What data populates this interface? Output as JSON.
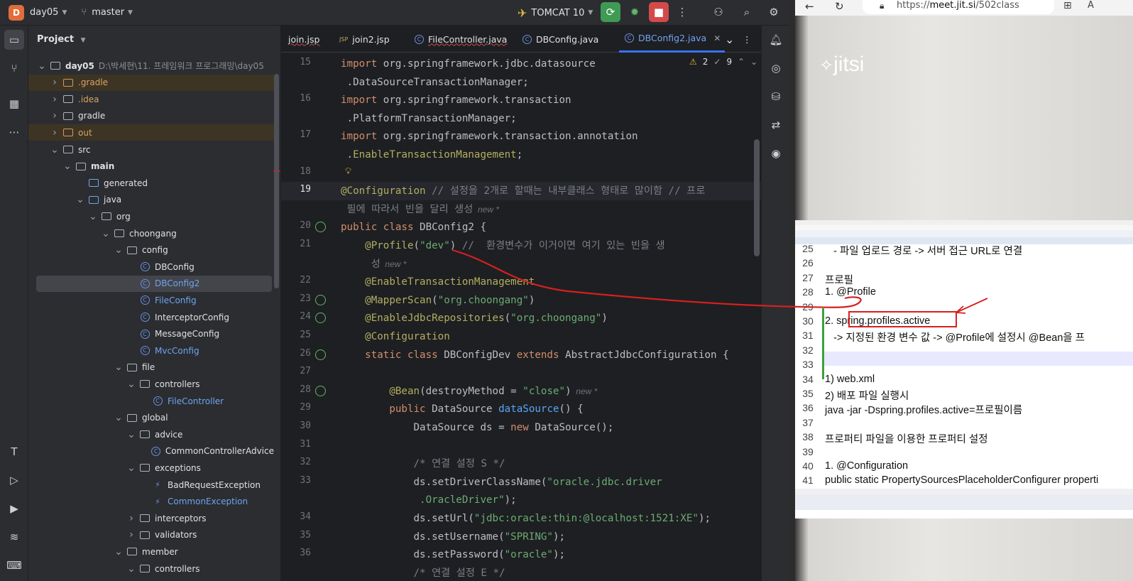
{
  "ide": {
    "project_name": "day05",
    "branch": "master",
    "run_config": "TOMCAT 10",
    "project_panel_title": "Project",
    "tree": [
      {
        "label": "day05",
        "path": "D:\\박세현\\11. 프레임워크 프로그래밍\\day05",
        "indent": 0,
        "arrow": "v",
        "icon": "folder",
        "bold": true
      },
      {
        "label": ".gradle",
        "indent": 1,
        "arrow": ">",
        "icon": "folder-orange",
        "color": "orange",
        "excluded": true
      },
      {
        "label": ".idea",
        "indent": 1,
        "arrow": ">",
        "icon": "folder",
        "color": "orange"
      },
      {
        "label": "gradle",
        "indent": 1,
        "arrow": ">",
        "icon": "folder"
      },
      {
        "label": "out",
        "indent": 1,
        "arrow": ">",
        "icon": "folder-orange",
        "color": "orange",
        "excluded": true
      },
      {
        "label": "src",
        "indent": 1,
        "arrow": "v",
        "icon": "folder"
      },
      {
        "label": "main",
        "indent": 2,
        "arrow": "v",
        "icon": "folder",
        "bold": true
      },
      {
        "label": "generated",
        "indent": 3,
        "arrow": "",
        "icon": "folder-blue"
      },
      {
        "label": "java",
        "indent": 3,
        "arrow": "v",
        "icon": "folder-blue"
      },
      {
        "label": "org",
        "indent": 4,
        "arrow": "v",
        "icon": "package"
      },
      {
        "label": "choongang",
        "indent": 5,
        "arrow": "v",
        "icon": "package"
      },
      {
        "label": "config",
        "indent": 6,
        "arrow": "v",
        "icon": "package"
      },
      {
        "label": "DBConfig",
        "indent": 7,
        "arrow": "",
        "icon": "class"
      },
      {
        "label": "DBConfig2",
        "indent": 7,
        "arrow": "",
        "icon": "class",
        "selected": true,
        "color": "blue"
      },
      {
        "label": "FileConfig",
        "indent": 7,
        "arrow": "",
        "icon": "class",
        "color": "blue"
      },
      {
        "label": "InterceptorConfig",
        "indent": 7,
        "arrow": "",
        "icon": "class"
      },
      {
        "label": "MessageConfig",
        "indent": 7,
        "arrow": "",
        "icon": "class"
      },
      {
        "label": "MvcConfig",
        "indent": 7,
        "arrow": "",
        "icon": "class",
        "color": "blue"
      },
      {
        "label": "file",
        "indent": 6,
        "arrow": "v",
        "icon": "package"
      },
      {
        "label": "controllers",
        "indent": 7,
        "arrow": "v",
        "icon": "package"
      },
      {
        "label": "FileController",
        "indent": 8,
        "arrow": "",
        "icon": "class",
        "color": "blue"
      },
      {
        "label": "global",
        "indent": 6,
        "arrow": "v",
        "icon": "package"
      },
      {
        "label": "advice",
        "indent": 7,
        "arrow": "v",
        "icon": "package"
      },
      {
        "label": "CommonControllerAdvice",
        "indent": 8,
        "arrow": "",
        "icon": "class"
      },
      {
        "label": "exceptions",
        "indent": 7,
        "arrow": "v",
        "icon": "package"
      },
      {
        "label": "BadRequestException",
        "indent": 8,
        "arrow": "",
        "icon": "exception"
      },
      {
        "label": "CommonException",
        "indent": 8,
        "arrow": "",
        "icon": "exception",
        "color": "blue"
      },
      {
        "label": "interceptors",
        "indent": 7,
        "arrow": ">",
        "icon": "package"
      },
      {
        "label": "validators",
        "indent": 7,
        "arrow": ">",
        "icon": "package"
      },
      {
        "label": "member",
        "indent": 6,
        "arrow": "v",
        "icon": "package"
      },
      {
        "label": "controllers",
        "indent": 7,
        "arrow": "v",
        "icon": "package"
      }
    ],
    "tabs": [
      {
        "label": "join.jsp",
        "icon": "jsp",
        "error": true
      },
      {
        "label": "join2.jsp",
        "icon": "jsp",
        "error": false
      },
      {
        "label": "FileController.java",
        "icon": "class",
        "error": true
      },
      {
        "label": "DBConfig.java",
        "icon": "class",
        "error": false
      },
      {
        "label": "DBConfig2.java",
        "icon": "class",
        "error": false,
        "active": true
      }
    ],
    "inspections": {
      "warnings": "2",
      "weak_warnings": "9"
    },
    "hint_new": "new *",
    "code_lines": [
      {
        "n": "15",
        "parts": [
          [
            "kw",
            "import "
          ],
          [
            "pl",
            "org.springframework.jdbc.datasource"
          ]
        ]
      },
      {
        "n": "",
        "parts": [
          [
            "pl",
            " .DataSourceTransactionManager;"
          ]
        ]
      },
      {
        "n": "16",
        "parts": [
          [
            "kw",
            "import "
          ],
          [
            "pl",
            "org.springframework.transaction"
          ]
        ]
      },
      {
        "n": "",
        "parts": [
          [
            "pl",
            " .PlatformTransactionManager;"
          ]
        ]
      },
      {
        "n": "17",
        "parts": [
          [
            "kw",
            "import "
          ],
          [
            "pl",
            "org.springframework.transaction.annotation"
          ]
        ]
      },
      {
        "n": "",
        "parts": [
          [
            "pl",
            " ."
          ],
          [
            "an",
            "EnableTransactionManagement"
          ],
          [
            "pl",
            ";"
          ]
        ]
      },
      {
        "n": "18",
        "parts": []
      },
      {
        "n": "19",
        "parts": [
          [
            "an",
            "@Configuration"
          ],
          [
            "cm",
            " // 설정을 2개로 할때는 내부클래스 형태로 많이함 // 프로"
          ]
        ]
      },
      {
        "n": "",
        "parts": [
          [
            "cm",
            " 필에 따라서 빈을 달리 생성"
          ]
        ],
        "hint": true
      },
      {
        "n": "20",
        "parts": [
          [
            "kw",
            "public class "
          ],
          [
            "pl",
            "DBConfig2 {"
          ]
        ]
      },
      {
        "n": "21",
        "parts": [
          [
            "pl",
            "    "
          ],
          [
            "an",
            "@Profile"
          ],
          [
            "pl",
            "("
          ],
          [
            "st",
            "\"dev\""
          ],
          [
            "pl",
            ") "
          ],
          [
            "cm",
            "//  환경변수가 이거이면 여기 있는 빈을 생"
          ]
        ]
      },
      {
        "n": "",
        "parts": [
          [
            "cm",
            "     성"
          ]
        ],
        "hint": true
      },
      {
        "n": "22",
        "parts": [
          [
            "pl",
            "    "
          ],
          [
            "an",
            "@EnableTransactionManagement"
          ]
        ]
      },
      {
        "n": "23",
        "parts": [
          [
            "pl",
            "    "
          ],
          [
            "an",
            "@MapperScan"
          ],
          [
            "pl",
            "("
          ],
          [
            "st",
            "\"org.choongang\""
          ],
          [
            "pl",
            ")"
          ]
        ]
      },
      {
        "n": "24",
        "parts": [
          [
            "pl",
            "    "
          ],
          [
            "an",
            "@EnableJdbcRepositories"
          ],
          [
            "pl",
            "("
          ],
          [
            "st",
            "\"org.choongang\""
          ],
          [
            "pl",
            ")"
          ]
        ]
      },
      {
        "n": "25",
        "parts": [
          [
            "pl",
            "    "
          ],
          [
            "an",
            "@Configuration"
          ]
        ]
      },
      {
        "n": "26",
        "parts": [
          [
            "pl",
            "    "
          ],
          [
            "kw",
            "static class "
          ],
          [
            "pl",
            "DBConfigDev "
          ],
          [
            "kw",
            "extends "
          ],
          [
            "pl",
            "AbstractJdbcConfiguration {"
          ]
        ]
      },
      {
        "n": "27",
        "parts": []
      },
      {
        "n": "28",
        "parts": [
          [
            "pl",
            "        "
          ],
          [
            "an",
            "@Bean"
          ],
          [
            "pl",
            "(destroyMethod = "
          ],
          [
            "st",
            "\"close\""
          ],
          [
            "pl",
            ")"
          ]
        ],
        "hint": true
      },
      {
        "n": "29",
        "parts": [
          [
            "pl",
            "        "
          ],
          [
            "kw",
            "public "
          ],
          [
            "pl",
            "DataSource "
          ],
          [
            "fn",
            "dataSource"
          ],
          [
            "pl",
            "() {"
          ]
        ]
      },
      {
        "n": "30",
        "parts": [
          [
            "pl",
            "            DataSource ds = "
          ],
          [
            "kw",
            "new "
          ],
          [
            "pl",
            "DataSource();"
          ]
        ]
      },
      {
        "n": "31",
        "parts": []
      },
      {
        "n": "32",
        "parts": [
          [
            "pl",
            "            "
          ],
          [
            "cm",
            "/* 연결 설정 S */"
          ]
        ]
      },
      {
        "n": "33",
        "parts": [
          [
            "pl",
            "            ds.setDriverClassName("
          ],
          [
            "st",
            "\"oracle.jdbc.driver"
          ]
        ]
      },
      {
        "n": "",
        "parts": [
          [
            "st",
            "             .OracleDriver\""
          ],
          [
            "pl",
            ");"
          ]
        ]
      },
      {
        "n": "34",
        "parts": [
          [
            "pl",
            "            ds.setUrl("
          ],
          [
            "st",
            "\"jdbc:oracle:thin:@localhost:1521:XE\""
          ],
          [
            "pl",
            ");"
          ]
        ]
      },
      {
        "n": "35",
        "parts": [
          [
            "pl",
            "            ds.setUsername("
          ],
          [
            "st",
            "\"SPRING\""
          ],
          [
            "pl",
            ");"
          ]
        ]
      },
      {
        "n": "36",
        "parts": [
          [
            "pl",
            "            ds.setPassword("
          ],
          [
            "st",
            "\"oracle\""
          ],
          [
            "pl",
            ");"
          ]
        ]
      },
      {
        "n": "",
        "parts": [
          [
            "cm",
            "            /* 연결 설정 E */"
          ]
        ]
      }
    ]
  },
  "browser": {
    "url_prefix": "https://",
    "url_host": "meet.jit.si",
    "url_path": "/502class",
    "logo": "jitsi",
    "notepad_lines": [
      {
        "n": "25",
        "t": "   - 파일 업로드 경로 -> 서버 접근 URL로 연결"
      },
      {
        "n": "26",
        "t": ""
      },
      {
        "n": "27",
        "t": "프로필"
      },
      {
        "n": "28",
        "t": "1. @Profile"
      },
      {
        "n": "29",
        "t": ""
      },
      {
        "n": "30",
        "t": "2. spring.profiles.active"
      },
      {
        "n": "31",
        "t": "   -> 지정된 환경 변수 값 -> @Profile에 설정시 @Bean을 프"
      },
      {
        "n": "32",
        "t": ""
      },
      {
        "n": "33",
        "t": ""
      },
      {
        "n": "34",
        "t": "1) web.xml"
      },
      {
        "n": "35",
        "t": "2) 배포 파일 실행시"
      },
      {
        "n": "36",
        "t": "java -jar -Dspring.profiles.active=프로필이름"
      },
      {
        "n": "37",
        "t": ""
      },
      {
        "n": "38",
        "t": "프로퍼티 파일을 이용한 프로퍼티 설정"
      },
      {
        "n": "39",
        "t": ""
      },
      {
        "n": "40",
        "t": "1. @Configuration"
      },
      {
        "n": "41",
        "t": "public static PropertySourcesPlaceholderConfigurer properti"
      }
    ]
  },
  "colors": {
    "accent": "#3574f0",
    "annotation_red": "#d42020",
    "run_green": "#3f9a53",
    "stop_red": "#d44a4a"
  }
}
